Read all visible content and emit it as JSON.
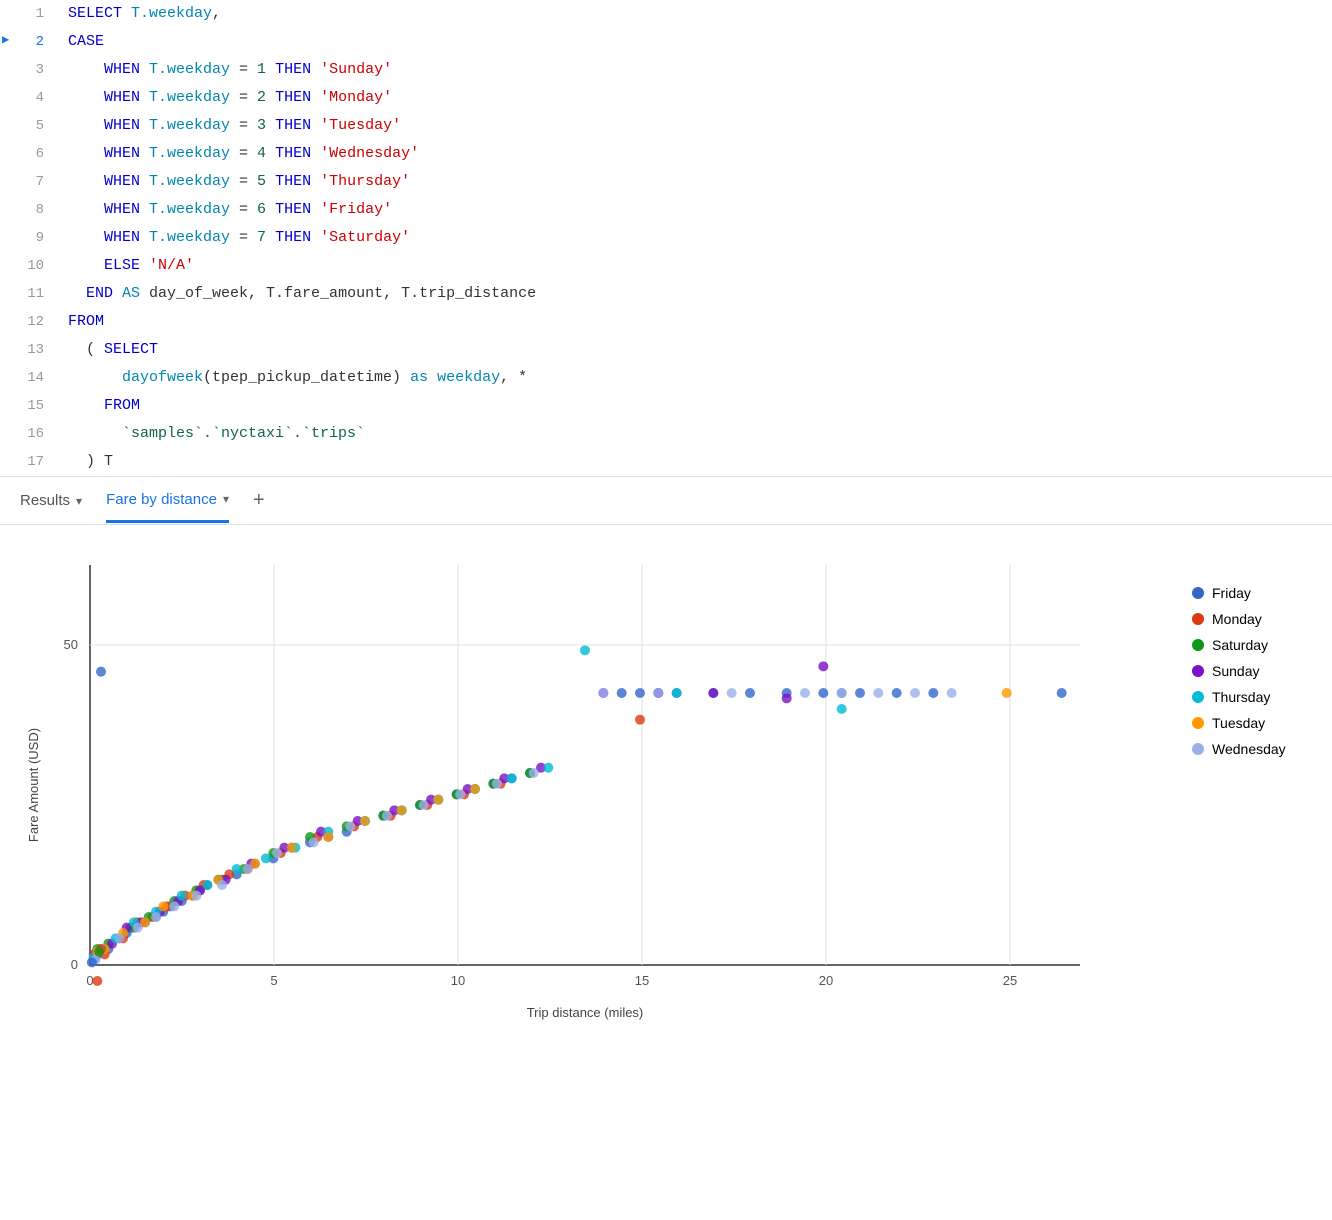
{
  "code": {
    "lines": [
      {
        "num": 1,
        "active": false,
        "tokens": [
          {
            "type": "kw",
            "text": "SELECT "
          },
          {
            "type": "field",
            "text": "T.weekday"
          },
          {
            "type": "plain",
            "text": ","
          }
        ]
      },
      {
        "num": 2,
        "active": true,
        "tokens": [
          {
            "type": "kw",
            "text": "CASE"
          }
        ]
      },
      {
        "num": 3,
        "active": false,
        "tokens": [
          {
            "type": "kw",
            "text": "    WHEN "
          },
          {
            "type": "field",
            "text": "T.weekday"
          },
          {
            "type": "plain",
            "text": " = "
          },
          {
            "type": "num",
            "text": "1"
          },
          {
            "type": "kw",
            "text": " THEN "
          },
          {
            "type": "str",
            "text": "'Sunday'"
          }
        ]
      },
      {
        "num": 4,
        "active": false,
        "tokens": [
          {
            "type": "kw",
            "text": "    WHEN "
          },
          {
            "type": "field",
            "text": "T.weekday"
          },
          {
            "type": "plain",
            "text": " = "
          },
          {
            "type": "num",
            "text": "2"
          },
          {
            "type": "kw",
            "text": " THEN "
          },
          {
            "type": "str",
            "text": "'Monday'"
          }
        ]
      },
      {
        "num": 5,
        "active": false,
        "tokens": [
          {
            "type": "kw",
            "text": "    WHEN "
          },
          {
            "type": "field",
            "text": "T.weekday"
          },
          {
            "type": "plain",
            "text": " = "
          },
          {
            "type": "num",
            "text": "3"
          },
          {
            "type": "kw",
            "text": " THEN "
          },
          {
            "type": "str",
            "text": "'Tuesday'"
          }
        ]
      },
      {
        "num": 6,
        "active": false,
        "tokens": [
          {
            "type": "kw",
            "text": "    WHEN "
          },
          {
            "type": "field",
            "text": "T.weekday"
          },
          {
            "type": "plain",
            "text": " = "
          },
          {
            "type": "num",
            "text": "4"
          },
          {
            "type": "kw",
            "text": " THEN "
          },
          {
            "type": "str",
            "text": "'Wednesday'"
          }
        ]
      },
      {
        "num": 7,
        "active": false,
        "tokens": [
          {
            "type": "kw",
            "text": "    WHEN "
          },
          {
            "type": "field",
            "text": "T.weekday"
          },
          {
            "type": "plain",
            "text": " = "
          },
          {
            "type": "num",
            "text": "5"
          },
          {
            "type": "kw",
            "text": " THEN "
          },
          {
            "type": "str",
            "text": "'Thursday'"
          }
        ]
      },
      {
        "num": 8,
        "active": false,
        "tokens": [
          {
            "type": "kw",
            "text": "    WHEN "
          },
          {
            "type": "field",
            "text": "T.weekday"
          },
          {
            "type": "plain",
            "text": " = "
          },
          {
            "type": "num",
            "text": "6"
          },
          {
            "type": "kw",
            "text": " THEN "
          },
          {
            "type": "str",
            "text": "'Friday'"
          }
        ]
      },
      {
        "num": 9,
        "active": false,
        "tokens": [
          {
            "type": "kw",
            "text": "    WHEN "
          },
          {
            "type": "field",
            "text": "T.weekday"
          },
          {
            "type": "plain",
            "text": " = "
          },
          {
            "type": "num",
            "text": "7"
          },
          {
            "type": "kw",
            "text": " THEN "
          },
          {
            "type": "str",
            "text": "'Saturday'"
          }
        ]
      },
      {
        "num": 10,
        "active": false,
        "tokens": [
          {
            "type": "kw",
            "text": "    ELSE "
          },
          {
            "type": "str",
            "text": "'N/A'"
          }
        ]
      },
      {
        "num": 11,
        "active": false,
        "tokens": [
          {
            "type": "kw",
            "text": "  END "
          },
          {
            "type": "as-kw",
            "text": "AS"
          },
          {
            "type": "plain",
            "text": " day_of_week, T.fare_amount, T.trip_distance"
          }
        ]
      },
      {
        "num": 12,
        "active": false,
        "tokens": [
          {
            "type": "kw",
            "text": "FROM"
          }
        ]
      },
      {
        "num": 13,
        "active": false,
        "tokens": [
          {
            "type": "plain",
            "text": "  ( "
          },
          {
            "type": "kw",
            "text": "SELECT"
          }
        ]
      },
      {
        "num": 14,
        "active": false,
        "tokens": [
          {
            "type": "plain",
            "text": "      "
          },
          {
            "type": "fn",
            "text": "dayofweek"
          },
          {
            "type": "plain",
            "text": "(tpep_pickup_datetime) "
          },
          {
            "type": "as-kw",
            "text": "as"
          },
          {
            "type": "plain",
            "text": " "
          },
          {
            "type": "field",
            "text": "weekday"
          },
          {
            "type": "plain",
            "text": ", *"
          }
        ]
      },
      {
        "num": 15,
        "active": false,
        "tokens": [
          {
            "type": "plain",
            "text": "    "
          },
          {
            "type": "kw",
            "text": "FROM"
          }
        ]
      },
      {
        "num": 16,
        "active": false,
        "tokens": [
          {
            "type": "plain",
            "text": "      "
          },
          {
            "type": "tick",
            "text": "`samples`.`nyctaxi`.`trips`"
          }
        ]
      },
      {
        "num": 17,
        "active": false,
        "tokens": [
          {
            "type": "plain",
            "text": "  ) T"
          }
        ]
      }
    ]
  },
  "tabs": {
    "results": {
      "label": "Results",
      "chevron": "▾",
      "active": false
    },
    "fare_by_distance": {
      "label": "Fare by distance",
      "chevron": "▾",
      "active": true
    },
    "add": "+"
  },
  "chart": {
    "title": "Fare by distance",
    "x_label": "Trip distance (miles)",
    "y_label": "Fare Amount (USD)",
    "x_ticks": [
      "0",
      "5",
      "10",
      "15",
      "20",
      "25"
    ],
    "y_ticks": [
      "0",
      "50"
    ],
    "legend": [
      {
        "label": "Friday",
        "color": "#3366cc"
      },
      {
        "label": "Monday",
        "color": "#dc3912"
      },
      {
        "label": "Saturday",
        "color": "#109618"
      },
      {
        "label": "Sunday",
        "color": "#7b10c8"
      },
      {
        "label": "Thursday",
        "color": "#00bcd4"
      },
      {
        "label": "Tuesday",
        "color": "#ff9900"
      },
      {
        "label": "Wednesday",
        "color": "#9ab0e8"
      }
    ]
  }
}
